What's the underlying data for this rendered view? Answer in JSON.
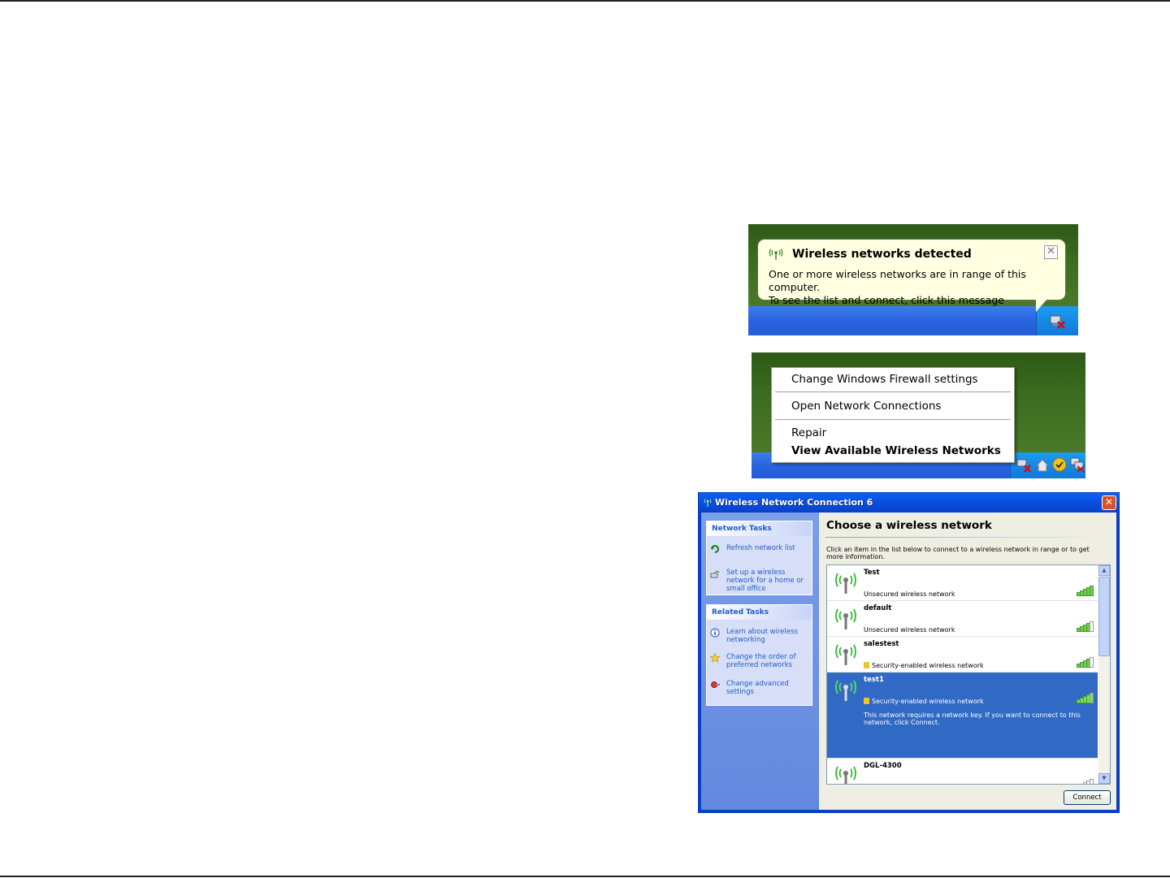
{
  "balloon": {
    "title": "Wireless networks detected",
    "line1": "One or more wireless networks are in range of this computer.",
    "line2": "To see the list and connect, click this message",
    "close_glyph": "✕",
    "icon": "wireless-antenna-icon"
  },
  "context_menu": {
    "items": [
      "Change Windows Firewall settings",
      "Open Network Connections",
      "Repair",
      "View Available Wireless Networks"
    ]
  },
  "window": {
    "title": "Wireless Network Connection 6",
    "close_glyph": "✕",
    "network_tasks": {
      "heading": "Network Tasks",
      "items": [
        "Refresh network list",
        "Set up a wireless network for a home or small office"
      ]
    },
    "related_tasks": {
      "heading": "Related Tasks",
      "items": [
        "Learn about wireless networking",
        "Change the order of preferred networks",
        "Change advanced settings"
      ]
    },
    "heading": "Choose a wireless network",
    "instructions": "Click an item in the list below to connect to a wireless network in range or to get more information.",
    "networks": [
      {
        "name": "Test",
        "status": "Unsecured wireless network",
        "secured": false,
        "signal": 5
      },
      {
        "name": "default",
        "status": "Unsecured wireless network",
        "secured": false,
        "signal": 4
      },
      {
        "name": "salestest",
        "status": "Security-enabled wireless network",
        "secured": true,
        "signal": 4
      },
      {
        "name": "test1",
        "status": "Security-enabled wireless network",
        "secured": true,
        "signal": 4,
        "note": "This network requires a network key. If you want to connect to this network, click Connect."
      },
      {
        "name": "DGL-4300",
        "status": "",
        "secured": false,
        "signal": 2
      }
    ],
    "selected_network": "test1",
    "connect_label": "Connect",
    "scroll_up_glyph": "▲",
    "scroll_down_glyph": "▼"
  },
  "colors": {
    "balloon_bg": "#ffffe1",
    "xp_title_blue": "#0a4fe0",
    "selection": "#316ac5",
    "task_link": "#215dc6"
  }
}
